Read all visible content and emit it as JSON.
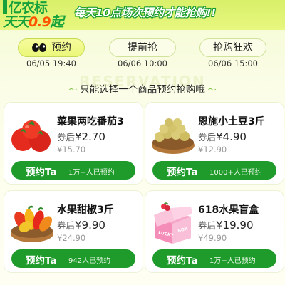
{
  "banner": {
    "brand_top": "亿农标",
    "brand_bottom_prefix": "天天",
    "brand_bottom_price": "0.9",
    "brand_bottom_suffix": "起",
    "slogan": "每天10点场次预约才能抢购!!"
  },
  "tabs": [
    {
      "label": "预约",
      "time": "06/05 19:40",
      "active": true
    },
    {
      "label": "提前抢",
      "time": "06/06 10:00",
      "active": false
    },
    {
      "label": "抢购狂欢",
      "time": "06/06 15:00",
      "active": false
    }
  ],
  "watermark": "RESERVATION",
  "subtitle": "只能选择一个商品预约抢购哦",
  "products": [
    {
      "name": "菜果两吃番茄3",
      "price_prefix": "券后",
      "price": "¥2.70",
      "original": "¥15.70",
      "cta": "预约Ta",
      "count": "1万+人已预约",
      "image": "tomato-image"
    },
    {
      "name": "恩施小土豆3斤",
      "price_prefix": "券后",
      "price": "¥4.90",
      "original": "¥12.90",
      "cta": "预约Ta",
      "count": "1000+人已预约",
      "image": "potato-image"
    },
    {
      "name": "水果甜椒3斤",
      "price_prefix": "券后",
      "price": "¥9.90",
      "original": "¥24.90",
      "cta": "预约Ta",
      "count": "942人已预约",
      "image": "pepper-image"
    },
    {
      "name": "618水果盲盒",
      "price_prefix": "券后",
      "price": "¥19.90",
      "original": "¥49.90",
      "cta": "预约Ta",
      "count": "1万+人已预约",
      "image": "blind-box-image"
    }
  ],
  "colors": {
    "brand_green": "#17a13b",
    "cta_green": "#1f9b2c",
    "price_orange": "#ff5400",
    "tab_active": "#eaf77a"
  }
}
